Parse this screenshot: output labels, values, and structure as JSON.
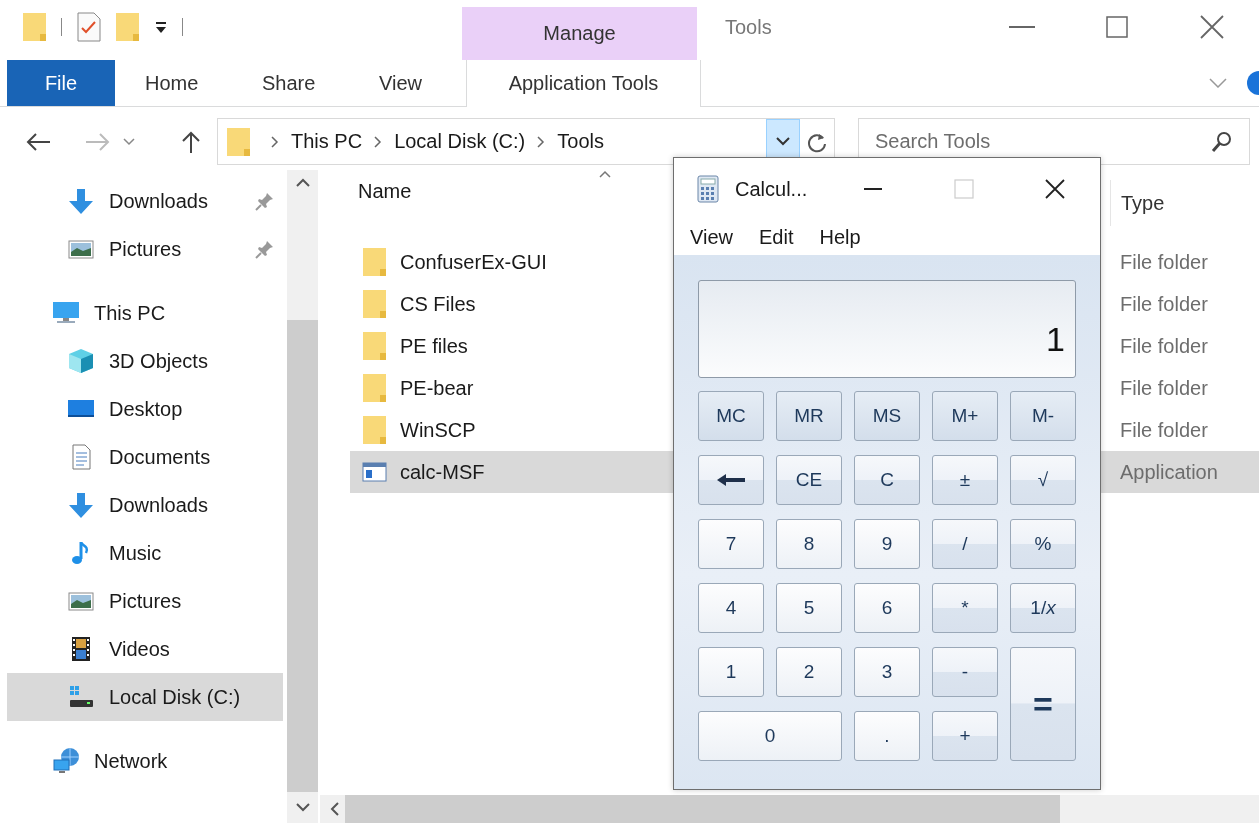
{
  "title_bar": {
    "context_group": "Manage",
    "title": "Tools"
  },
  "ribbon": {
    "tabs": [
      {
        "label": "File",
        "kind": "file",
        "selected": false
      },
      {
        "label": "Home",
        "kind": "standard",
        "selected": false
      },
      {
        "label": "Share",
        "kind": "standard",
        "selected": false
      },
      {
        "label": "View",
        "kind": "standard",
        "selected": false
      },
      {
        "label": "Application Tools",
        "kind": "contextual",
        "selected": false
      }
    ]
  },
  "address_bar": {
    "crumbs": [
      "This PC",
      "Local Disk (C:)",
      "Tools"
    ]
  },
  "search": {
    "placeholder": "Search Tools"
  },
  "nav_pane": {
    "quick_access_items": [
      {
        "label": "Downloads",
        "kind": "downloads",
        "pinned": true,
        "selected": false
      },
      {
        "label": "Pictures",
        "kind": "pictures",
        "pinned": true,
        "selected": false
      }
    ],
    "tree": [
      {
        "label": "This PC",
        "kind": "pc",
        "selected": false,
        "children": [
          {
            "label": "3D Objects",
            "kind": "objects3d",
            "selected": false
          },
          {
            "label": "Desktop",
            "kind": "desktop",
            "selected": false
          },
          {
            "label": "Documents",
            "kind": "documents",
            "selected": false
          },
          {
            "label": "Downloads",
            "kind": "downloads",
            "selected": false
          },
          {
            "label": "Music",
            "kind": "music",
            "selected": false
          },
          {
            "label": "Pictures",
            "kind": "pictures",
            "selected": false
          },
          {
            "label": "Videos",
            "kind": "videos",
            "selected": false
          },
          {
            "label": "Local Disk (C:)",
            "kind": "disk",
            "selected": true
          }
        ]
      },
      {
        "label": "Network",
        "kind": "network",
        "selected": false
      }
    ]
  },
  "file_list": {
    "columns": [
      "Name",
      "Type"
    ],
    "rows": [
      {
        "name": "ConfuserEx-GUI",
        "type": "File folder",
        "kind": "folder",
        "selected": false
      },
      {
        "name": "CS Files",
        "type": "File folder",
        "kind": "folder",
        "selected": false
      },
      {
        "name": "PE files",
        "type": "File folder",
        "kind": "folder",
        "selected": false
      },
      {
        "name": "PE-bear",
        "type": "File folder",
        "kind": "folder",
        "selected": false
      },
      {
        "name": "WinSCP",
        "type": "File folder",
        "kind": "folder",
        "selected": false
      },
      {
        "name": "calc-MSF",
        "type": "Application",
        "kind": "application",
        "selected": true
      }
    ]
  },
  "calculator": {
    "title": "Calcul...",
    "menu": [
      "View",
      "Edit",
      "Help"
    ],
    "display": "1",
    "keys": [
      {
        "label": "MC",
        "kind": "memory"
      },
      {
        "label": "MR",
        "kind": "memory"
      },
      {
        "label": "MS",
        "kind": "memory"
      },
      {
        "label": "M+",
        "kind": "memory"
      },
      {
        "label": "M-",
        "kind": "memory"
      },
      {
        "kind": "backspace"
      },
      {
        "label": "CE",
        "kind": "function"
      },
      {
        "label": "C",
        "kind": "function"
      },
      {
        "label": "±",
        "kind": "function"
      },
      {
        "label": "√",
        "kind": "function"
      },
      {
        "label": "7",
        "kind": "digit"
      },
      {
        "label": "8",
        "kind": "digit"
      },
      {
        "label": "9",
        "kind": "digit"
      },
      {
        "label": "/",
        "kind": "function"
      },
      {
        "label": "%",
        "kind": "function"
      },
      {
        "label": "4",
        "kind": "digit"
      },
      {
        "label": "5",
        "kind": "digit"
      },
      {
        "label": "6",
        "kind": "digit"
      },
      {
        "label": "*",
        "kind": "function"
      },
      {
        "label": "1/*x*",
        "kind": "function"
      },
      {
        "label": "1",
        "kind": "digit"
      },
      {
        "label": "2",
        "kind": "digit"
      },
      {
        "label": "3",
        "kind": "digit"
      },
      {
        "label": "-",
        "kind": "function"
      },
      {
        "label": "=",
        "kind": "equals"
      },
      {
        "label": "0",
        "kind": "wide_digit"
      },
      {
        "label": ".",
        "kind": "digit"
      },
      {
        "label": "+",
        "kind": "function"
      }
    ]
  }
}
